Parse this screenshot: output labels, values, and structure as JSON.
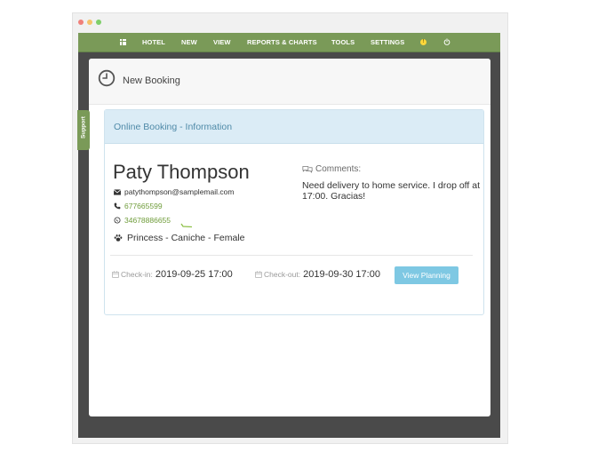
{
  "navbar": {
    "items": [
      "HOTEL",
      "NEW",
      "VIEW",
      "REPORTS & CHARTS",
      "TOOLS",
      "SETTINGS"
    ],
    "alert_badge": "!",
    "icons": [
      "grid-icon",
      "alert-icon",
      "power-icon"
    ],
    "color": "#7a9a58"
  },
  "sidebar": {
    "support_label": "Support"
  },
  "page": {
    "title": "New Booking"
  },
  "panel": {
    "title": "Online Booking - Information"
  },
  "guest": {
    "name": "Paty Thompson",
    "email": "patythompson@samplemail.com",
    "phone": "677665599",
    "whatsapp": "34678886655",
    "pet": "Princess - Caniche - Female"
  },
  "comments": {
    "label": "Comments:",
    "text": "Need delivery to home service. I drop off at 17:00. Gracias!"
  },
  "booking": {
    "checkin_label": "Check-in:",
    "checkin_value": "2019-09-25 17:00",
    "checkout_label": "Check-out:",
    "checkout_value": "2019-09-30 17:00",
    "view_planning_label": "View Planning"
  },
  "colors": {
    "accent_green": "#6f9c3a",
    "panel_heading_bg": "#dbecf6",
    "panel_title": "#4f8aa8",
    "button": "#7ec8e3"
  }
}
